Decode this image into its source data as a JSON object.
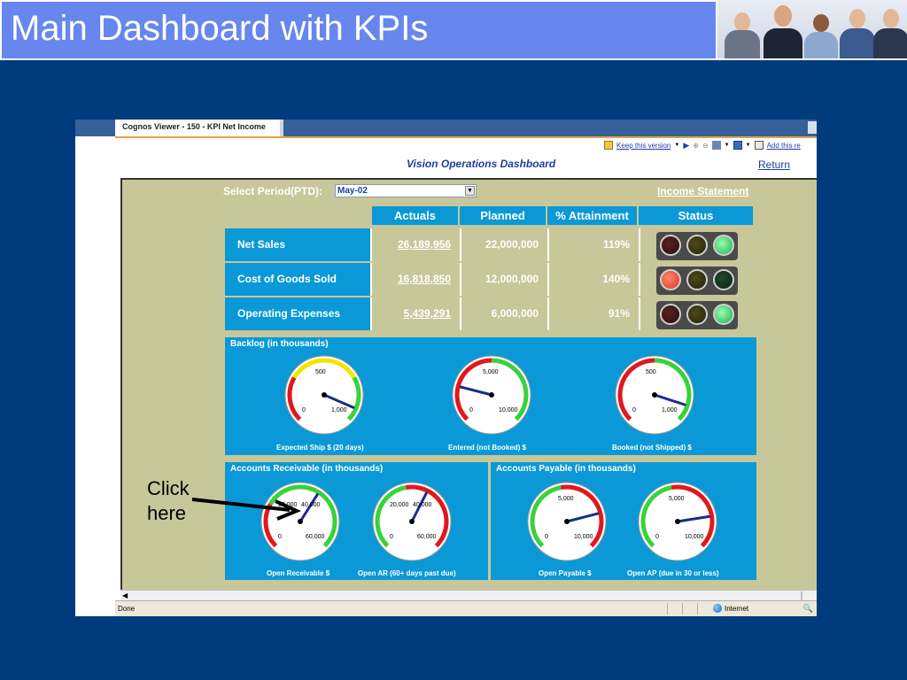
{
  "slide": {
    "title": "Main Dashboard with KPIs",
    "annotation": [
      "Click",
      "here"
    ]
  },
  "browser": {
    "tab_title": "Cognos Viewer - 150 - KPI Net Income",
    "toolbar": {
      "keep_version": "Keep this version",
      "add_this": "Add this re"
    },
    "status": "Done",
    "zone": "Internet"
  },
  "dashboard": {
    "title": "Vision Operations Dashboard",
    "return_link": "Return",
    "period_label": "Select Period(PTD):",
    "period_value": "May-02",
    "income_statement_link": "Income Statement",
    "table": {
      "headers": [
        "Actuals",
        "Planned",
        "% Attainment",
        "Status"
      ],
      "rows": [
        {
          "label": "Net Sales",
          "actuals": "26,189,956",
          "planned": "22,000,000",
          "attainment": "119%",
          "status": "green"
        },
        {
          "label": "Cost of Goods Sold",
          "actuals": "16,818,850",
          "planned": "12,000,000",
          "attainment": "140%",
          "status": "red"
        },
        {
          "label": "Operating Expenses",
          "actuals": "5,439,291",
          "planned": "6,000,000",
          "attainment": "91%",
          "status": "green"
        }
      ]
    },
    "backlog": {
      "title": "Backlog (in thousands)",
      "gauges": [
        {
          "label": "Expected Ship $ (20 days)",
          "ticks": [
            "0",
            "500",
            "1,000"
          ],
          "needle_fraction": 0.92
        },
        {
          "label": "Entered (not Booked) $",
          "ticks": [
            "0",
            "5,000",
            "10,000"
          ],
          "needle_fraction": 0.22
        },
        {
          "label": "Booked (not Shipped) $",
          "ticks": [
            "0",
            "500",
            "1,000"
          ],
          "needle_fraction": 0.9
        }
      ]
    },
    "receivable": {
      "title": "Accounts Receivable (in thousands)",
      "gauges": [
        {
          "label": "Open Receivable $",
          "ticks": [
            "0",
            "20,000",
            "40,000",
            "60,000"
          ],
          "needle_fraction": 0.62
        },
        {
          "label": "Open AR (60+ days past due)",
          "ticks": [
            "0",
            "20,000",
            "40,000",
            "60,000"
          ],
          "needle_fraction": 0.6
        }
      ]
    },
    "payable": {
      "title": "Accounts Payable (in thousands)",
      "gauges": [
        {
          "label": "Open Payable $",
          "ticks": [
            "0",
            "5,000",
            "10,000"
          ],
          "needle_fraction": 0.78
        },
        {
          "label": "Open AP (due in 30 or less)",
          "ticks": [
            "0",
            "5,000",
            "10,000"
          ],
          "needle_fraction": 0.8
        }
      ]
    }
  },
  "colors": {
    "slide_bg": "#003c7d",
    "title_bar": "#6787ee",
    "panel_blue": "#0a99d6",
    "olive_bg": "#c8c79a",
    "gauge_red": "#e0191f",
    "gauge_yellow": "#f5e400",
    "gauge_green": "#3ad13a",
    "needle": "#1c2a8a"
  }
}
